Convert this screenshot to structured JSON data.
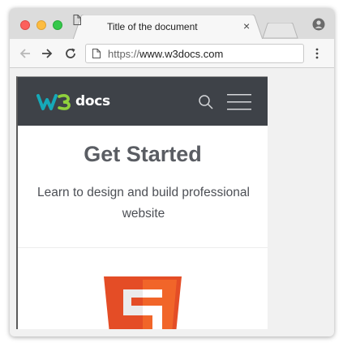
{
  "browser": {
    "tab": {
      "title": "Title of the document",
      "close_glyph": "×",
      "icon": "document-icon"
    },
    "new_tab_icon": "new-tab-icon",
    "profile_icon": "profile-icon",
    "toolbar": {
      "back_icon": "back-arrow-icon",
      "forward_icon": "forward-arrow-icon",
      "reload_icon": "reload-icon",
      "url_scheme": "https://",
      "url_host": "www.w3docs.com",
      "menu_icon": "kebab-menu-icon"
    }
  },
  "page": {
    "header": {
      "logo_mark": "W3",
      "logo_text": "docs",
      "search_icon": "search-icon",
      "menu_icon": "hamburger-menu-icon",
      "background": "#3e4248",
      "logo_accent": "#16a9b8"
    },
    "hero": {
      "title": "Get Started",
      "subtitle": "Learn to design and build professional website"
    },
    "html5_badge": {
      "icon": "html5-icon",
      "color": "#e44d26"
    }
  }
}
